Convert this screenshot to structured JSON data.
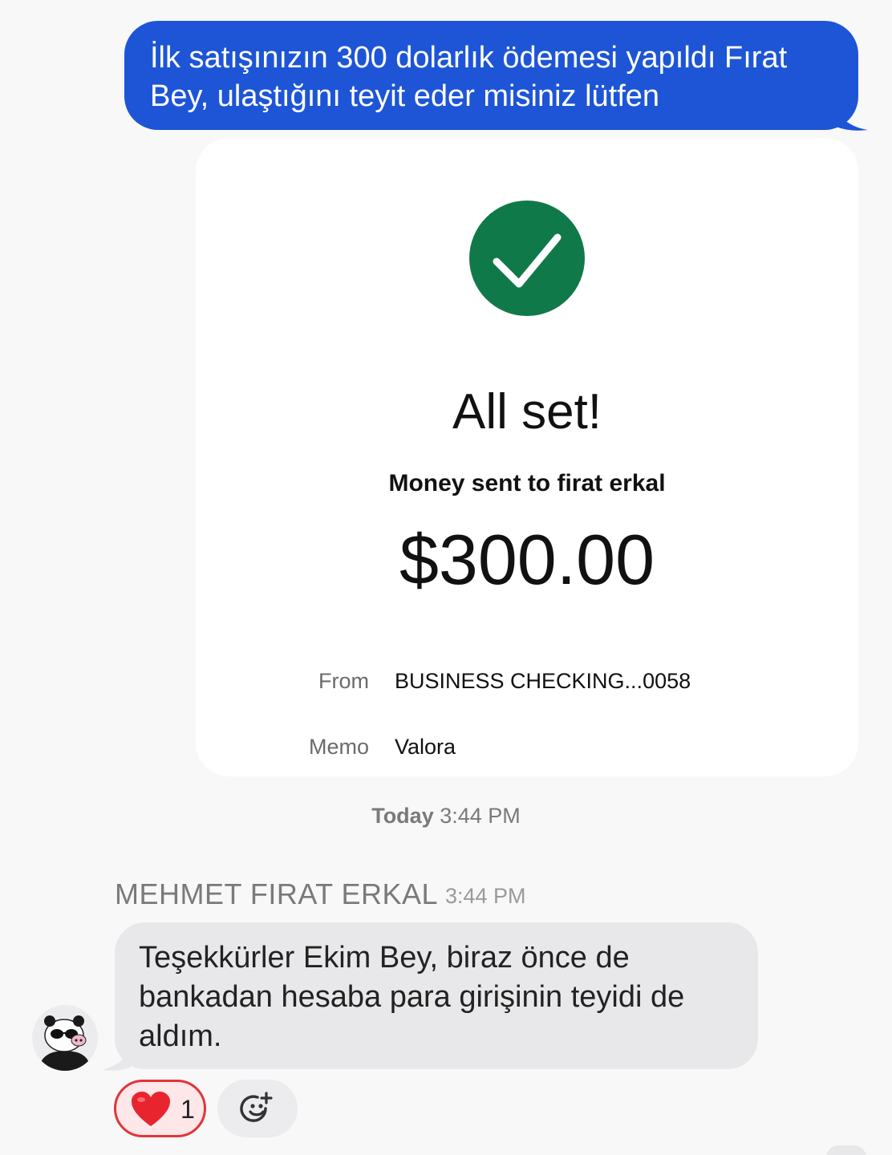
{
  "outgoing_message": {
    "text": "İlk satışınızın 300 dolarlık ödemesi yapıldı Fırat Bey, ulaştığını teyit eder misiniz lütfen",
    "bubble_color": "#1d55d6"
  },
  "payment_card": {
    "icon": "check-circle-icon",
    "status_color": "#10794a",
    "title": "All set!",
    "subtitle": "Money sent to firat erkal",
    "amount": "$300.00",
    "details": [
      {
        "label": "From",
        "value": "BUSINESS CHECKING...0058"
      },
      {
        "label": "Memo",
        "value": "Valora"
      }
    ]
  },
  "timestamp": {
    "day": "Today",
    "time": "3:44 PM"
  },
  "incoming_message": {
    "sender": "MEHMET FIRAT ERKAL",
    "time": "3:44 PM",
    "text": "Teşekkürler Ekim Bey, biraz önce de bankadan hesaba para girişinin teyidi de aldım.",
    "avatar_icon": "panda-avatar-icon"
  },
  "reactions": {
    "heart": {
      "icon": "heart-icon",
      "count": "1",
      "color": "#e0353b"
    },
    "add_reaction_icon": "add-emoji-icon"
  }
}
